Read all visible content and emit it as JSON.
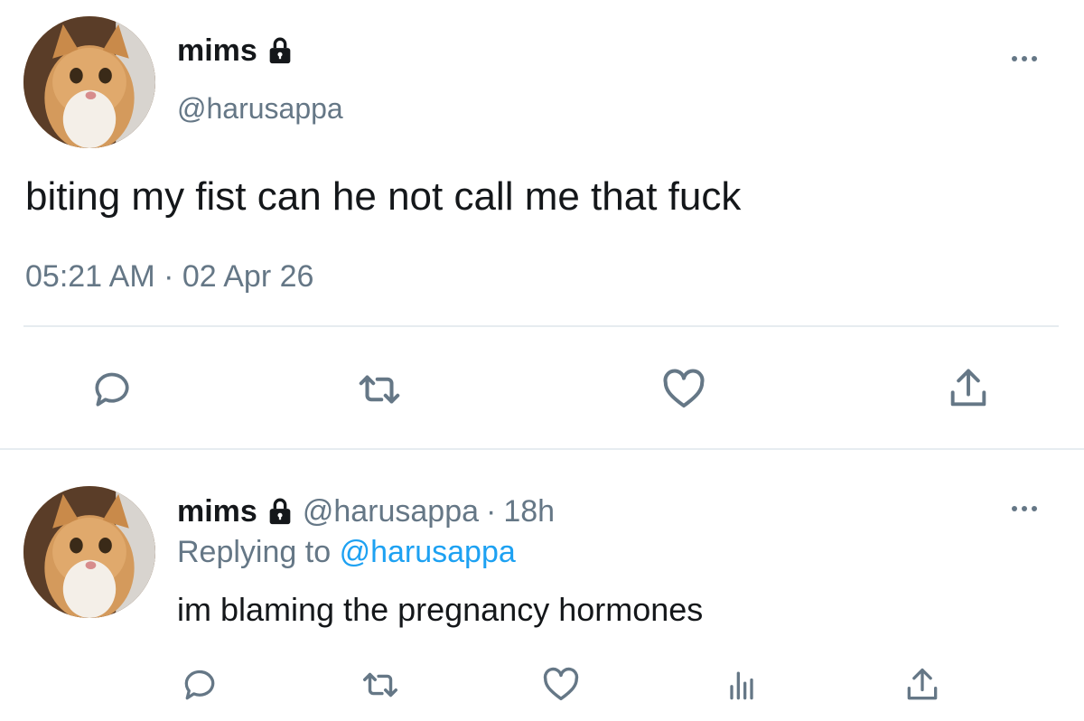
{
  "main_tweet": {
    "display_name": "mims",
    "handle": "@harusappa",
    "text": "biting my fist can he not call me that fuck",
    "timestamp": "05:21 AM · 02 Apr 26",
    "avatar_icon": "cat-avatar",
    "locked_icon": "lock-icon",
    "actions": [
      "reply-icon",
      "retweet-icon",
      "like-icon",
      "share-icon"
    ]
  },
  "reply_tweet": {
    "display_name": "mims",
    "handle": "@harusappa",
    "separator": "·",
    "time_ago": "18h",
    "replying_label": "Replying to",
    "replying_handle": "@harusappa",
    "text": "im blaming the pregnancy hormones",
    "actions": [
      "reply-icon",
      "retweet-icon",
      "like-icon",
      "analytics-icon",
      "share-icon"
    ]
  },
  "colors": {
    "text": "#14171a",
    "muted": "#657786",
    "link": "#1da1f2",
    "divider": "#e6ecf0"
  }
}
